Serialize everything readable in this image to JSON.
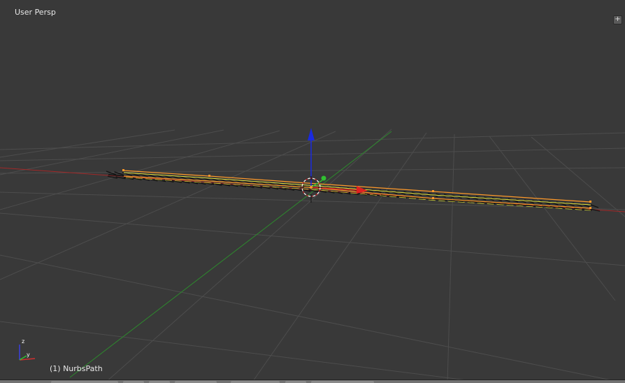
{
  "viewport": {
    "view_label": "User Persp",
    "object_label": "(1) NurbsPath",
    "corner_widget_symbol": "+",
    "background_color": "#393939"
  },
  "axes_colors": {
    "x": "#a32828",
    "y": "#2d8a2d",
    "z": "#1a2ae0",
    "grid": "#4d4d4d",
    "curve_wire": "#111111",
    "curve_selected": "#ff9a2a",
    "curve_normal": "#e8e840"
  },
  "icons": {
    "object_origin": "3d-cursor-icon",
    "axis_gizmo": "axis-orientation-icon",
    "manipulator": "transform-manipulator-icon"
  }
}
